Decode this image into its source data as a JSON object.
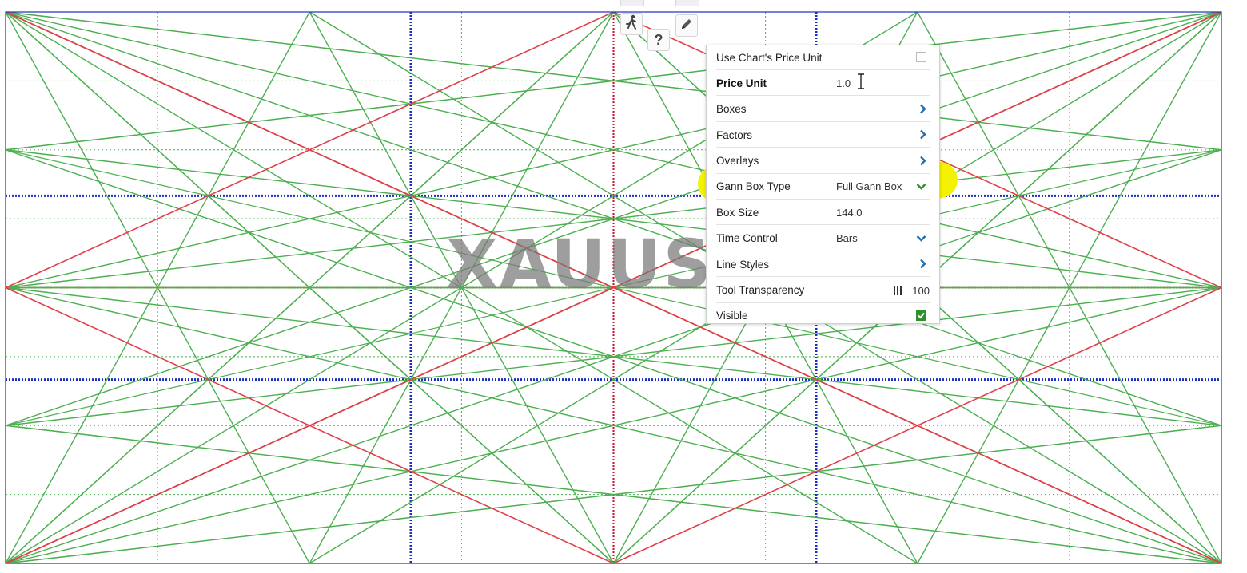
{
  "colors": {
    "background": "#ffffff",
    "green_fan": "#4caf50",
    "red_diagonal": "#e0404a",
    "blue_division": "#1a2fbf",
    "green_grid": "#4caf50",
    "red_center": "#c8102e",
    "highlight": "#f3f300",
    "accent_chevron": "#1f6fb5",
    "check_green": "#2f8f2f"
  },
  "watermark": {
    "text": "XAUUS"
  },
  "toolbar": {
    "run_icon": "person-running-icon",
    "help_label": "?",
    "edit_icon": "pencil-icon"
  },
  "settings_panel": {
    "rows": [
      {
        "label": "Use Chart's Price Unit",
        "value": "",
        "control": "checkbox",
        "checked": false
      },
      {
        "label": "Price Unit",
        "value": "1.0",
        "control": "text"
      },
      {
        "label": "Boxes",
        "value": "",
        "control": "chevron-right"
      },
      {
        "label": "Factors",
        "value": "",
        "control": "chevron-right"
      },
      {
        "label": "Overlays",
        "value": "",
        "control": "chevron-right"
      },
      {
        "label": "Gann Box Type",
        "value": "Full Gann Box",
        "control": "chevron-down"
      },
      {
        "label": "Box Size",
        "value": "144.0",
        "control": "text"
      },
      {
        "label": "Time Control",
        "value": "Bars",
        "control": "chevron-down"
      },
      {
        "label": "Line Styles",
        "value": "",
        "control": "chevron-right"
      },
      {
        "label": "Tool Transparency",
        "value": "100",
        "control": "slider-grip"
      },
      {
        "label": "Visible",
        "value": "",
        "control": "checkbox",
        "checked": true
      }
    ]
  }
}
